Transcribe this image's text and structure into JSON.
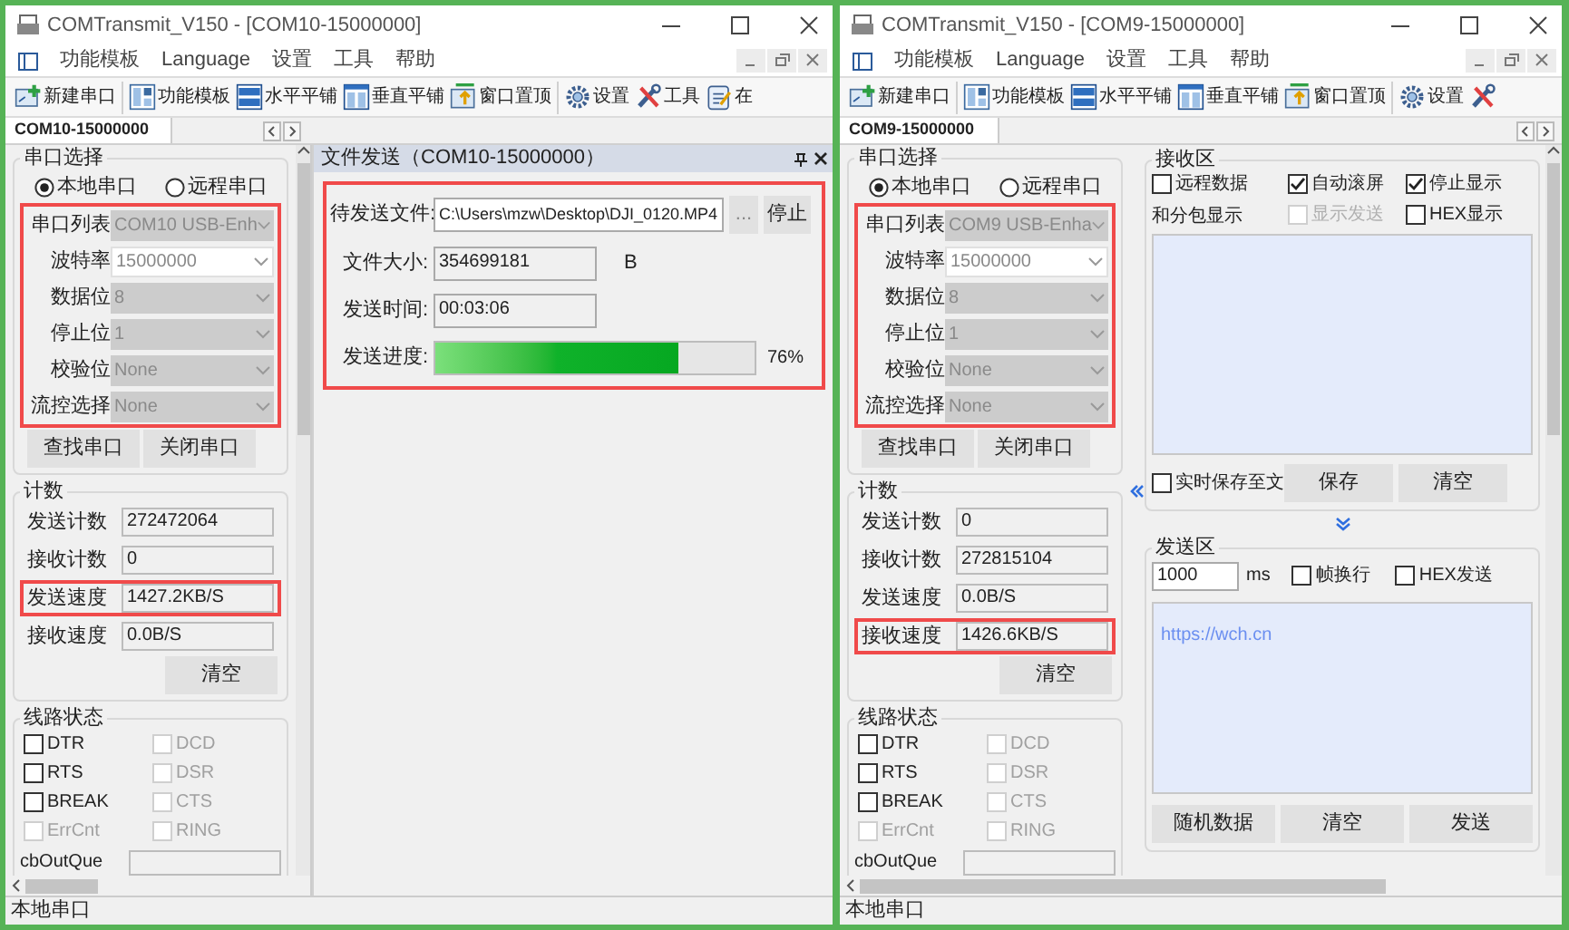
{
  "windows": [
    {
      "kind": "file_send",
      "title": "COMTransmit_V150 - [COM10-15000000]",
      "menu": [
        "功能模板",
        "Language",
        "设置",
        "工具",
        "帮助"
      ],
      "toolbar": [
        {
          "kind": "labeled",
          "label": "新建串口"
        },
        {
          "kind": "labeled",
          "label": "功能模板"
        },
        {
          "kind": "labeled",
          "label": "水平平铺"
        },
        {
          "kind": "labeled",
          "label": "垂直平铺"
        },
        {
          "kind": "labeled",
          "label": "窗口置顶"
        },
        {
          "kind": "labeled",
          "label": "设置"
        },
        {
          "kind": "labeled",
          "label": "工具"
        },
        {
          "kind": "labeled",
          "label": "在"
        }
      ],
      "doc_tab": "COM10-15000000",
      "port_select": {
        "title": "串口选择",
        "highlighted": true,
        "modes": [
          {
            "label": "本地串口",
            "selected": true
          },
          {
            "label": "远程串口",
            "selected": false
          }
        ],
        "fields": [
          {
            "label": "串口列表",
            "value": "COM10  USB-Enh",
            "disabled": true
          },
          {
            "label": "波特率",
            "value": "15000000",
            "disabled": false
          },
          {
            "label": "数据位",
            "value": "8",
            "disabled": true
          },
          {
            "label": "停止位",
            "value": "1",
            "disabled": true
          },
          {
            "label": "校验位",
            "value": "None",
            "disabled": true
          },
          {
            "label": "流控选择",
            "value": "None",
            "disabled": true
          }
        ],
        "buttons": [
          "查找串口",
          "关闭串口"
        ]
      },
      "counts": {
        "title": "计数",
        "clear": "清空",
        "rows": [
          {
            "label": "发送计数",
            "value": "272472064",
            "highlighted": false
          },
          {
            "label": "接收计数",
            "value": "0",
            "highlighted": false
          },
          {
            "label": "发送速度",
            "value": "1427.2KB/S",
            "highlighted": true
          },
          {
            "label": "接收速度",
            "value": "0.0B/S",
            "highlighted": false
          }
        ]
      },
      "line_status": {
        "title": "线路状态",
        "queue_label": "cbOutQue",
        "signals": [
          {
            "label": "DTR",
            "checked": false,
            "disabled": false
          },
          {
            "label": "DCD",
            "checked": false,
            "disabled": true
          },
          {
            "label": "RTS",
            "checked": false,
            "disabled": false
          },
          {
            "label": "DSR",
            "checked": false,
            "disabled": true
          },
          {
            "label": "BREAK",
            "checked": false,
            "disabled": false
          },
          {
            "label": "CTS",
            "checked": false,
            "disabled": true
          },
          {
            "label": "ErrCnt",
            "checked": false,
            "disabled": true
          },
          {
            "label": "RING",
            "checked": false,
            "disabled": true
          }
        ]
      },
      "file_send": {
        "title": "文件发送（COM10-15000000）",
        "highlighted": true,
        "file_label": "待发送文件:",
        "file_path": "C:\\Users\\mzw\\Desktop\\DJI_0120.MP4",
        "browse": "...",
        "stop": "停止",
        "size_label": "文件大小:",
        "size": "354699181",
        "size_unit": "B",
        "time_label": "发送时间:",
        "time": "00:03:06",
        "progress_label": "发送进度:",
        "level": 0.76,
        "percent": "76%"
      },
      "status_bar": "本地串口"
    },
    {
      "kind": "comm",
      "title": "COMTransmit_V150 - [COM9-15000000]",
      "menu": [
        "功能模板",
        "Language",
        "设置",
        "工具",
        "帮助"
      ],
      "toolbar": [
        {
          "kind": "labeled",
          "label": "新建串口"
        },
        {
          "kind": "labeled",
          "label": "功能模板"
        },
        {
          "kind": "labeled",
          "label": "水平平铺"
        },
        {
          "kind": "labeled",
          "label": "垂直平铺"
        },
        {
          "kind": "labeled",
          "label": "窗口置顶"
        },
        {
          "kind": "labeled",
          "label": "设置"
        },
        {
          "kind": "icon_only"
        }
      ],
      "doc_tab": "COM9-15000000",
      "port_select": {
        "title": "串口选择",
        "highlighted": true,
        "modes": [
          {
            "label": "本地串口",
            "selected": true
          },
          {
            "label": "远程串口",
            "selected": false
          }
        ],
        "fields": [
          {
            "label": "串口列表",
            "value": "COM9  USB-Enha",
            "disabled": true
          },
          {
            "label": "波特率",
            "value": "15000000",
            "disabled": false
          },
          {
            "label": "数据位",
            "value": "8",
            "disabled": true
          },
          {
            "label": "停止位",
            "value": "1",
            "disabled": true
          },
          {
            "label": "校验位",
            "value": "None",
            "disabled": true
          },
          {
            "label": "流控选择",
            "value": "None",
            "disabled": true
          }
        ],
        "buttons": [
          "查找串口",
          "关闭串口"
        ]
      },
      "counts": {
        "title": "计数",
        "clear": "清空",
        "rows": [
          {
            "label": "发送计数",
            "value": "0",
            "highlighted": false
          },
          {
            "label": "接收计数",
            "value": "272815104",
            "highlighted": false
          },
          {
            "label": "发送速度",
            "value": "0.0B/S",
            "highlighted": false
          },
          {
            "label": "接收速度",
            "value": "1426.6KB/S",
            "highlighted": true
          }
        ]
      },
      "line_status": {
        "title": "线路状态",
        "queue_label": "cbOutQue",
        "signals": [
          {
            "label": "DTR",
            "checked": false,
            "disabled": false
          },
          {
            "label": "DCD",
            "checked": false,
            "disabled": true
          },
          {
            "label": "RTS",
            "checked": false,
            "disabled": false
          },
          {
            "label": "DSR",
            "checked": false,
            "disabled": true
          },
          {
            "label": "BREAK",
            "checked": false,
            "disabled": false
          },
          {
            "label": "CTS",
            "checked": false,
            "disabled": true
          },
          {
            "label": "ErrCnt",
            "checked": false,
            "disabled": true
          },
          {
            "label": "RING",
            "checked": false,
            "disabled": true
          }
        ]
      },
      "receive": {
        "title": "接收区",
        "options": [
          {
            "kind": "checkbox",
            "label": "远程数据",
            "checked": false,
            "disabled": false
          },
          {
            "kind": "checkbox",
            "label": "自动滚屏",
            "checked": true,
            "disabled": false
          },
          {
            "kind": "checkbox",
            "label": "停止显示",
            "checked": true,
            "disabled": false
          },
          {
            "kind": "text",
            "label": "和分包显示"
          },
          {
            "kind": "checkbox",
            "label": "显示发送",
            "checked": false,
            "disabled": true
          },
          {
            "kind": "checkbox",
            "label": "HEX显示",
            "checked": false,
            "disabled": false
          }
        ],
        "save_option": {
          "label": "实时保存至文",
          "checked": false
        },
        "buttons": [
          "保存",
          "清空"
        ]
      },
      "send": {
        "title": "发送区",
        "interval": "1000",
        "unit": "ms",
        "options": [
          {
            "label": "帧换行",
            "checked": false
          },
          {
            "label": "HEX发送",
            "checked": false
          }
        ],
        "text": "https://wch.cn",
        "buttons": [
          "随机数据",
          "清空",
          "发送"
        ]
      },
      "status_bar": "本地串口"
    }
  ]
}
